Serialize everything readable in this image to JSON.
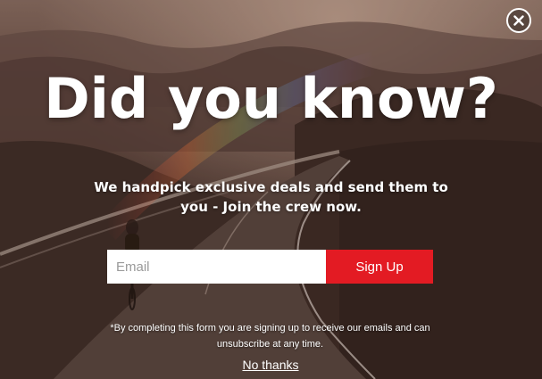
{
  "popup": {
    "headline": "Did you know?",
    "subtext": "We handpick exclusive deals and send them to you - Join the crew now.",
    "email_placeholder": "Email",
    "email_value": "",
    "signup_label": "Sign Up",
    "disclaimer": "*By completing this form you are signing up to receive our emails and can unsubscribe at any time.",
    "no_thanks_label": "No thanks",
    "close_icon": "close-icon",
    "background_icon": "mountain-road-cyclist-photo"
  },
  "colors": {
    "accent": "#e31b23",
    "text": "#ffffff",
    "overlay": "#3a2a24"
  }
}
